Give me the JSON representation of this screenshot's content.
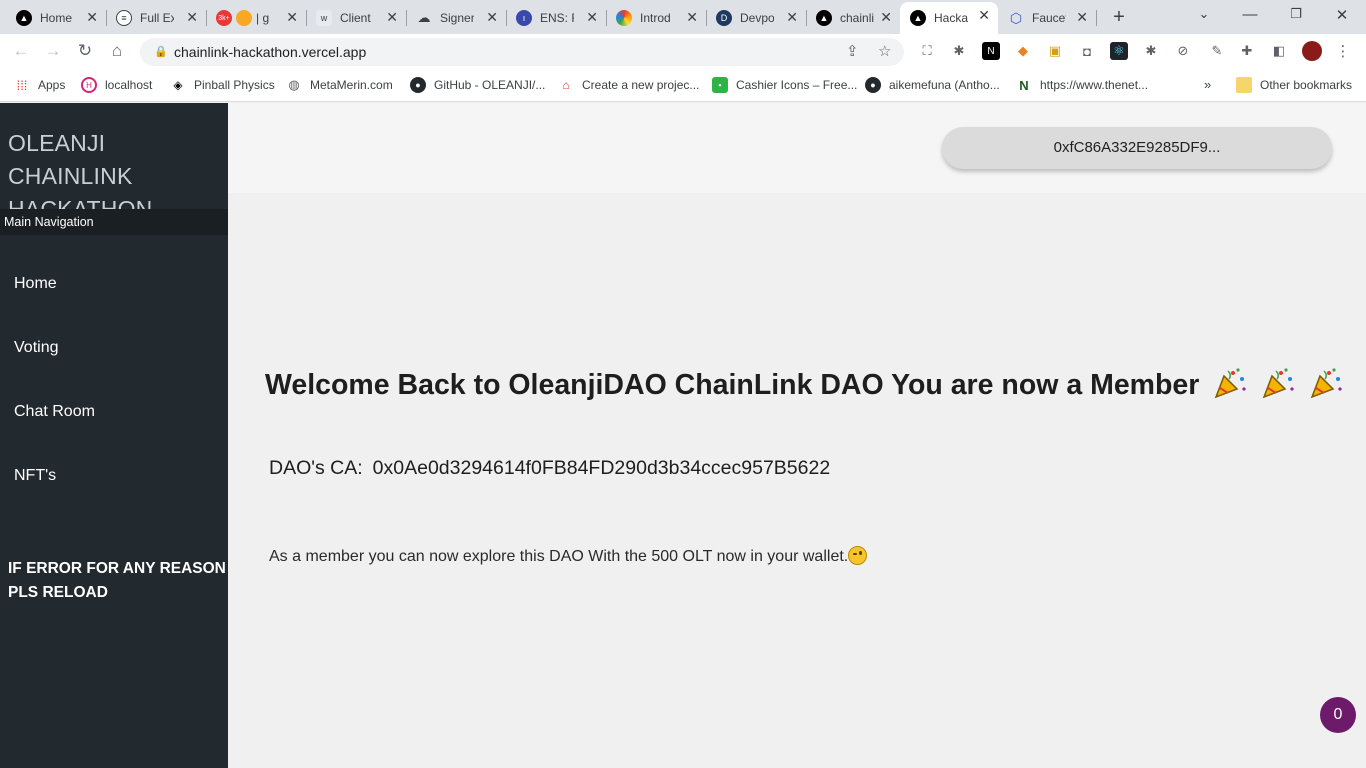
{
  "browser": {
    "tabs": [
      {
        "label": "Home",
        "icon": "vercel-triangle-icon",
        "color": "#000000"
      },
      {
        "label": "Full Ex",
        "icon": "document-icon",
        "color": "#3c4043"
      },
      {
        "label": "| g",
        "icon": "notification-badge-icon",
        "color": "#e53935",
        "badge": "3k+"
      },
      {
        "label": "Client",
        "icon": "w-logo-icon",
        "color": "#e8eaed"
      },
      {
        "label": "Signer",
        "icon": "cloud-icon",
        "color": "#3c4043"
      },
      {
        "label": "ENS: R",
        "icon": "chart-icon",
        "color": "#3949ab"
      },
      {
        "label": "Introd",
        "icon": "rainbow-icon",
        "color": "#ff9800"
      },
      {
        "label": "Devpo",
        "icon": "d-logo-icon",
        "color": "#1e3a5f"
      },
      {
        "label": "chainli",
        "icon": "vercel-triangle-icon",
        "color": "#000000"
      },
      {
        "label": "Hacka",
        "icon": "vercel-triangle-icon",
        "color": "#000000",
        "active": true
      },
      {
        "label": "Faucet",
        "icon": "chainlink-hexagon-icon",
        "color": "#375bd2"
      }
    ],
    "url": "chainlink-hackathon.vercel.app",
    "bookmarks": [
      {
        "label": "Apps",
        "icon": "apps-grid-icon"
      },
      {
        "label": "localhost",
        "icon": "localhost-icon"
      },
      {
        "label": "Pinball Physics",
        "icon": "codepen-icon"
      },
      {
        "label": "MetaMerin.com",
        "icon": "globe-icon"
      },
      {
        "label": "GitHub - OLEANJI/...",
        "icon": "github-icon"
      },
      {
        "label": "Create a new projec...",
        "icon": "store-icon"
      },
      {
        "label": "Cashier Icons – Free...",
        "icon": "cashier-icon"
      },
      {
        "label": "aikemefuna (Antho...",
        "icon": "github-icon"
      },
      {
        "label": "https://www.thenet...",
        "icon": "n-logo-icon"
      }
    ],
    "other_bookmarks": "Other bookmarks"
  },
  "sidebar": {
    "title": "OLEANJI CHAINLINK HACKATHON",
    "nav_heading": "Main Navigation",
    "items": [
      "Home",
      "Voting",
      "Chat Room",
      "NFT's"
    ],
    "error_note": "IF ERROR FOR ANY REASON PLS RELOAD"
  },
  "header": {
    "wallet_address": "0xfC86A332E9285DF9..."
  },
  "main": {
    "welcome": "Welcome Back to OleanjiDAO ChainLink DAO You are now a Member",
    "ca_label": "DAO's CA:",
    "ca_value": "0x0Ae0d3294614f0FB84FD290d3b34ccec957B5622",
    "message": "As a member you can now explore this DAO With the 500 OLT now in your wallet."
  },
  "chat_badge": "0"
}
